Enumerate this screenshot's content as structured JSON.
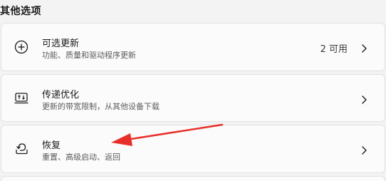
{
  "section": {
    "title": "其他选项"
  },
  "items": [
    {
      "title": "可选更新",
      "subtitle": "功能、质量和驱动程序更新",
      "status": "2 可用",
      "icon": "plus-circle-icon"
    },
    {
      "title": "传递优化",
      "subtitle": "更新的带宽限制，从其他设备下载",
      "icon": "delivery-optimization-icon"
    },
    {
      "title": "恢复",
      "subtitle": "重置、高级启动、返回",
      "icon": "recovery-icon"
    }
  ],
  "annotation": {
    "type": "red-arrow",
    "color": "#e8302a",
    "points_to": "恢复"
  }
}
